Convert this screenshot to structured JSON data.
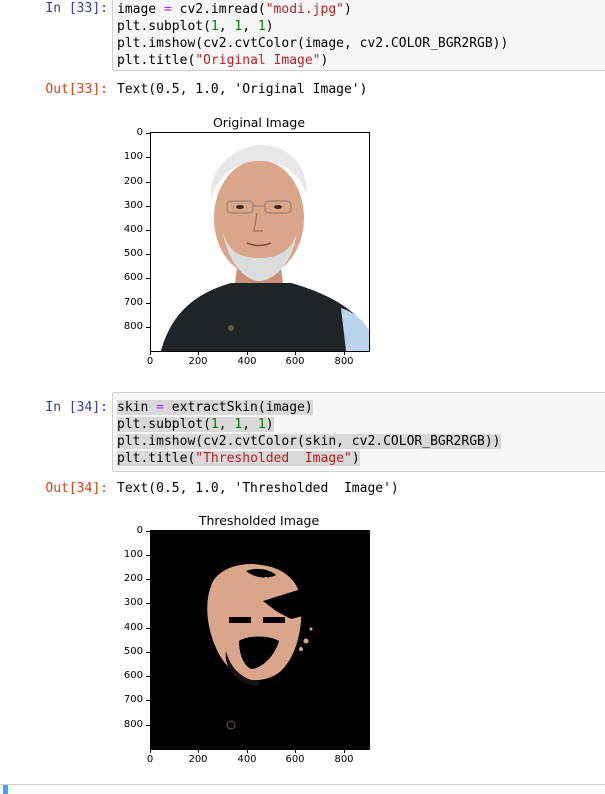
{
  "cells": [
    {
      "in_prompt": "In [33]:",
      "code_lines": [
        [
          {
            "t": "image "
          },
          {
            "t": "=",
            "c": "kw-eq"
          },
          {
            "t": " cv2.imread("
          },
          {
            "t": "\"modi.jpg\"",
            "c": "str"
          },
          {
            "t": ")"
          }
        ],
        [
          {
            "t": "plt.subplot("
          },
          {
            "t": "1",
            "c": "num"
          },
          {
            "t": ", "
          },
          {
            "t": "1",
            "c": "num"
          },
          {
            "t": ", "
          },
          {
            "t": "1",
            "c": "num"
          },
          {
            "t": ")"
          }
        ],
        [
          {
            "t": "plt.imshow(cv2.cvtColor(image, cv2.COLOR_BGR2RGB))"
          }
        ],
        [
          {
            "t": "plt.title("
          },
          {
            "t": "\"Original Image\"",
            "c": "str"
          },
          {
            "t": ")"
          }
        ]
      ],
      "out_prompt": "Out[33]:",
      "out_text": "Text(0.5, 1.0, 'Original Image')",
      "plot": {
        "title": "Original Image",
        "yticks": [
          "0",
          "100",
          "200",
          "300",
          "400",
          "500",
          "600",
          "700",
          "800"
        ],
        "xticks": [
          "0",
          "200",
          "400",
          "600",
          "800"
        ],
        "image_kind": "original"
      }
    },
    {
      "in_prompt": "In [34]:",
      "code_lines": [
        [
          {
            "t": "skin "
          },
          {
            "t": "=",
            "c": "kw-eq"
          },
          {
            "t": " extractSkin(image)"
          }
        ],
        [
          {
            "t": "plt.subplot("
          },
          {
            "t": "1",
            "c": "num"
          },
          {
            "t": ", "
          },
          {
            "t": "1",
            "c": "num"
          },
          {
            "t": ", "
          },
          {
            "t": "1",
            "c": "num"
          },
          {
            "t": ")"
          }
        ],
        [
          {
            "t": "plt.imshow(cv2.cvtColor(skin, cv2.COLOR_BGR2RGB))"
          }
        ],
        [
          {
            "t": "plt.title("
          },
          {
            "t": "\"Thresholded  Image\"",
            "c": "str"
          },
          {
            "t": ")"
          }
        ]
      ],
      "out_prompt": "Out[34]:",
      "out_text": "Text(0.5, 1.0, 'Thresholded  Image')",
      "plot": {
        "title": "Thresholded  Image",
        "yticks": [
          "0",
          "100",
          "200",
          "300",
          "400",
          "500",
          "600",
          "700",
          "800"
        ],
        "xticks": [
          "0",
          "200",
          "400",
          "600",
          "800"
        ],
        "image_kind": "thresholded"
      }
    }
  ],
  "colors": {
    "in_prompt": "#303f9f",
    "out_prompt": "#d84315",
    "string": "#ba2121",
    "number": "#008000",
    "operator": "#aa22ff",
    "jacket": "#1f2426",
    "shirt": "#b9d4ec",
    "skin": "#d9a68a",
    "hair": "#e8e8e8"
  }
}
